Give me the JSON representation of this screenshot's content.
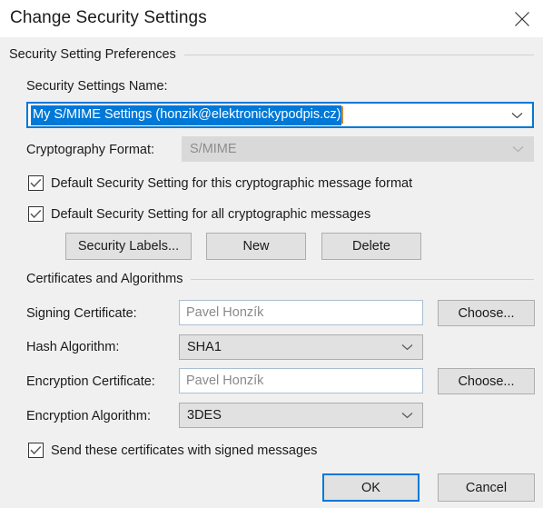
{
  "window": {
    "title": "Change Security Settings",
    "close_icon": "close-icon"
  },
  "groups": {
    "preferences": "Security Setting Preferences",
    "certificates": "Certificates and Algorithms"
  },
  "fields": {
    "security_settings_name": {
      "label": "Security Settings Name:",
      "value": "My S/MIME Settings (honzik@elektronickypodpis.cz)",
      "icon": "chevron-down-icon"
    },
    "cryptography_format": {
      "label": "Cryptography Format:",
      "value": "S/MIME",
      "icon": "chevron-down-icon"
    },
    "signing_certificate": {
      "label": "Signing Certificate:",
      "value": "Pavel Honzík",
      "choose_label": "Choose..."
    },
    "hash_algorithm": {
      "label": "Hash Algorithm:",
      "value": "SHA1",
      "icon": "chevron-down-icon"
    },
    "encryption_certificate": {
      "label": "Encryption Certificate:",
      "value": "Pavel Honzík",
      "choose_label": "Choose..."
    },
    "encryption_algorithm": {
      "label": "Encryption Algorithm:",
      "value": "3DES",
      "icon": "chevron-down-icon"
    }
  },
  "checkboxes": {
    "default_this_format": {
      "label": "Default Security Setting for this cryptographic message format",
      "checked": true
    },
    "default_all_messages": {
      "label": "Default Security Setting for all cryptographic messages",
      "checked": true
    },
    "send_certificates": {
      "label": "Send these certificates with signed messages",
      "checked": true
    }
  },
  "buttons": {
    "security_labels": "Security Labels...",
    "new": "New",
    "delete": "Delete",
    "ok": "OK",
    "cancel": "Cancel"
  },
  "colors": {
    "accent": "#0078d7",
    "window_bg": "#f0f0f0",
    "titlebar_bg": "#ffffff",
    "selection_bg": "#0078d7",
    "caret": "#c98b3c"
  }
}
